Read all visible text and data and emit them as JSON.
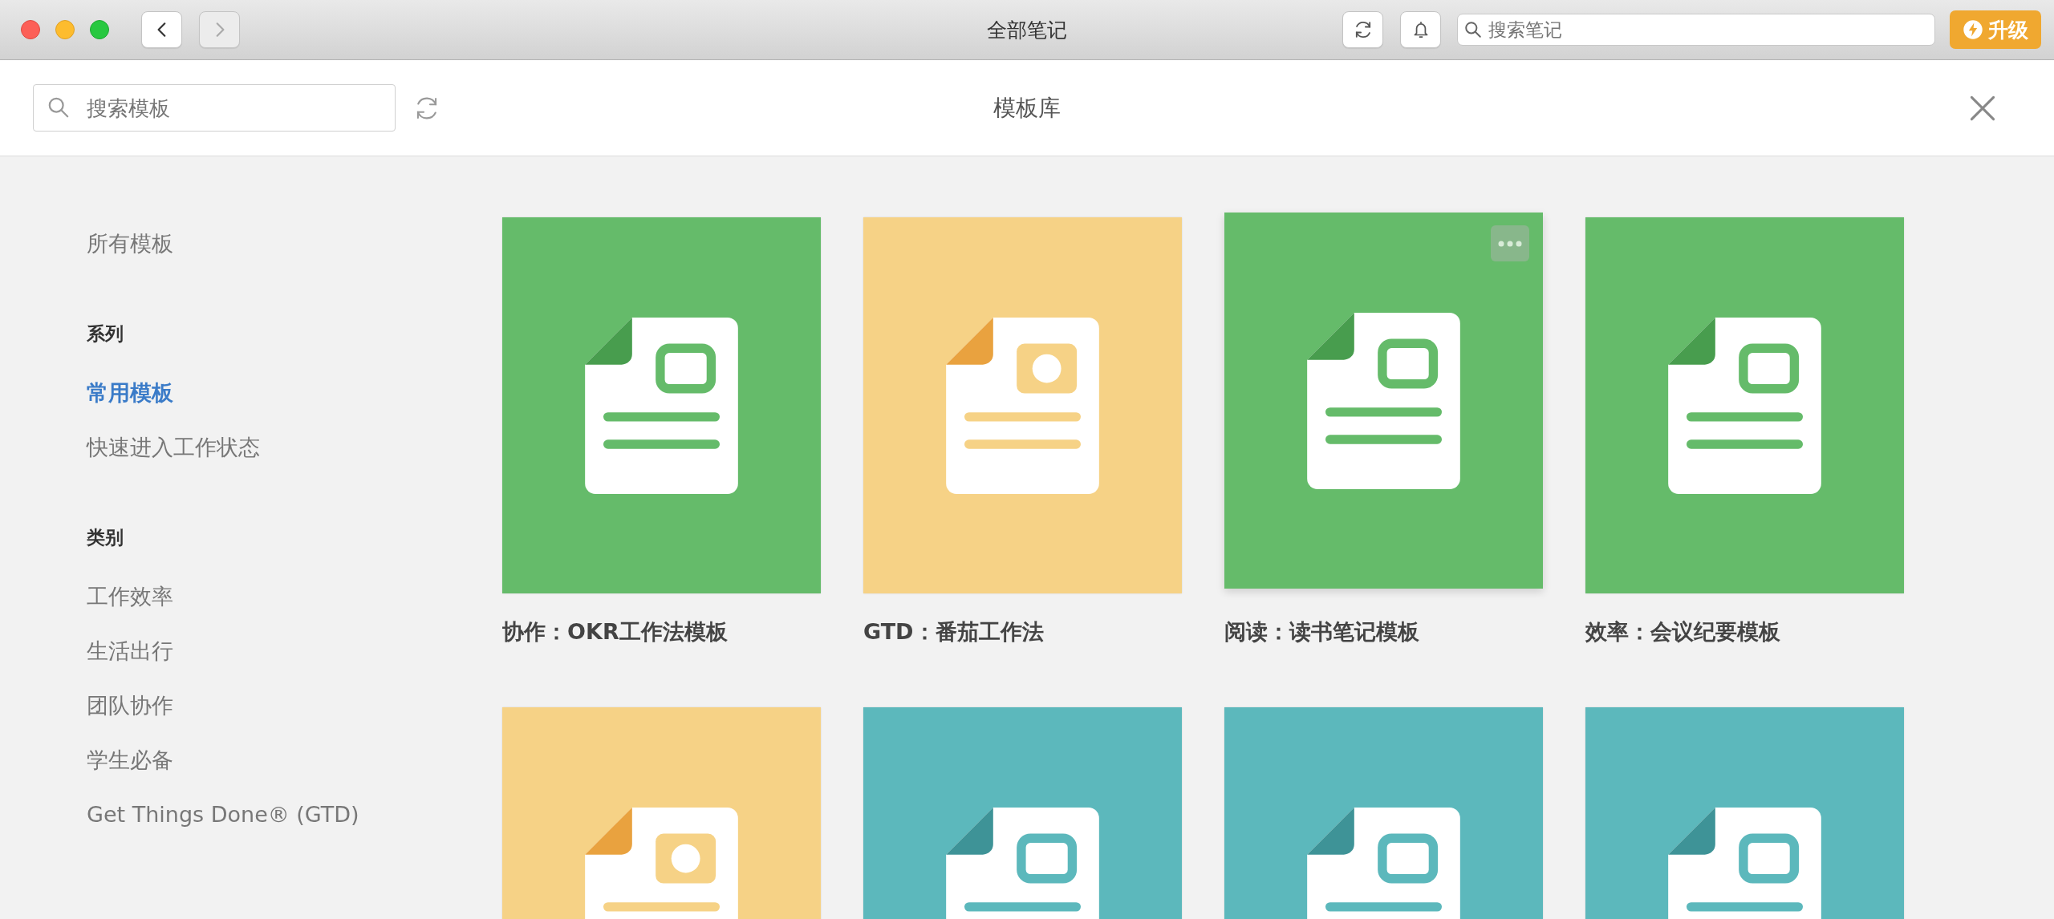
{
  "window": {
    "title": "全部笔记",
    "nav_buttons": [
      {
        "kind": "back",
        "disabled": false
      },
      {
        "kind": "forward",
        "disabled": true
      }
    ]
  },
  "toolbar": {
    "search": {
      "placeholder": "搜索笔记"
    },
    "upgrade_label": "升级"
  },
  "library": {
    "search": {
      "placeholder": "搜索模板"
    },
    "title": "模板库"
  },
  "sidebar": {
    "groups": [
      {
        "items": [
          {
            "label": "所有模板",
            "selected": false
          }
        ]
      },
      {
        "heading": "系列",
        "items": [
          {
            "label": "常用模板",
            "selected": true
          },
          {
            "label": "快速进入工作状态",
            "selected": false
          }
        ]
      },
      {
        "heading": "类别",
        "items": [
          {
            "label": "工作效率",
            "selected": false
          },
          {
            "label": "生活出行",
            "selected": false
          },
          {
            "label": "团队协作",
            "selected": false
          },
          {
            "label": "学生必备",
            "selected": false
          },
          {
            "label": "Get Things Done® (GTD)",
            "selected": false
          }
        ]
      }
    ]
  },
  "templates": [
    {
      "title": "协作：OKR工作法模板",
      "color": "#65bb6a",
      "kind": "frame",
      "hovered": false
    },
    {
      "title": "GTD：番茄工作法",
      "color": "#f6d286",
      "kind": "photo",
      "hovered": false
    },
    {
      "title": "阅读：读书笔记模板",
      "color": "#65bb6a",
      "kind": "frame",
      "hovered": true
    },
    {
      "title": "效率：会议纪要模板",
      "color": "#65bb6a",
      "kind": "frame",
      "hovered": false
    },
    {
      "color": "#f6d286",
      "kind": "photo",
      "hovered": false
    },
    {
      "color": "#5cb8bc",
      "kind": "frame",
      "hovered": false
    },
    {
      "color": "#5cb8bc",
      "kind": "frame",
      "hovered": false
    },
    {
      "color": "#5cb8bc",
      "kind": "frame",
      "hovered": false
    }
  ]
}
